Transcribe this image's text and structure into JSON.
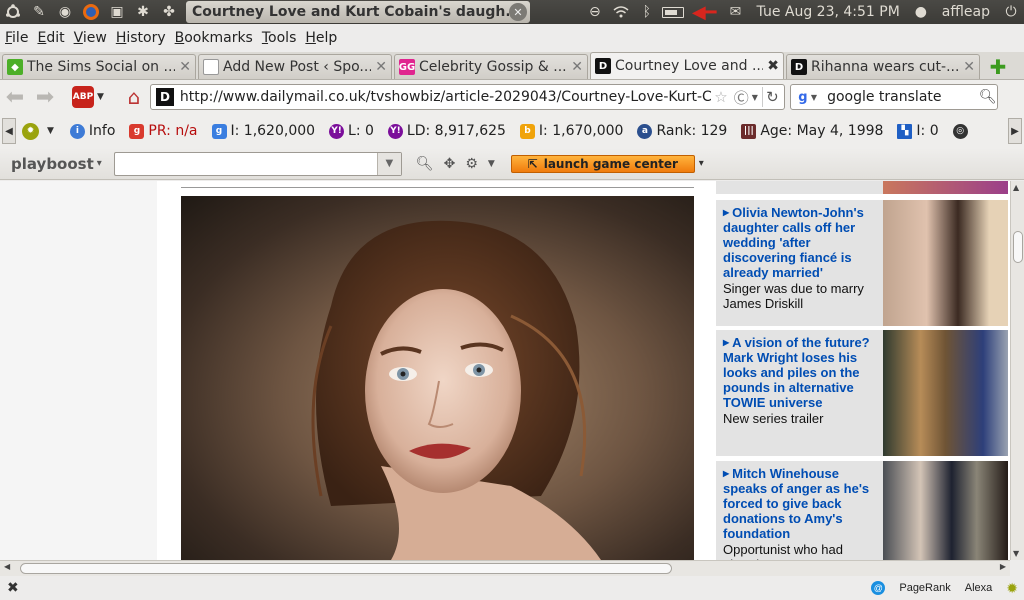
{
  "panel": {
    "active_task": "Courtney Love and Kurt Cobain's daugh...",
    "clock": "Tue Aug 23,  4:51 PM",
    "user": "affleap"
  },
  "menu": [
    "File",
    "Edit",
    "View",
    "History",
    "Bookmarks",
    "Tools",
    "Help"
  ],
  "tabs": [
    {
      "label": "The Sims Social on ...",
      "favicon": "sims-icon",
      "color": "#4caf28"
    },
    {
      "label": "Add New Post ‹ Spo...",
      "favicon": "page-icon",
      "color": "#ffffff"
    },
    {
      "label": "Celebrity Gossip & ...",
      "favicon": "gg-icon",
      "color": "#e0258f"
    },
    {
      "label": "Courtney Love and ...",
      "favicon": "dailymail-icon",
      "color": "#111111",
      "active": true
    },
    {
      "label": "Rihanna wears cut-...",
      "favicon": "dailymail-icon",
      "color": "#111111"
    }
  ],
  "nav": {
    "url": "http://www.dailymail.co.uk/tvshowbiz/article-2029043/Courtney-Love-Kurt-Cobain",
    "search": "google translate",
    "abp_label": "ABP"
  },
  "seo": {
    "info": "Info",
    "pr": "PR: n/a",
    "google_index": "I: 1,620,000",
    "yahoo_links": "L: 0",
    "yahoo_ld": "LD: 8,917,625",
    "bing_index": "I: 1,670,000",
    "alexa_rank": "Rank: 129",
    "age": "Age: May 4, 1998",
    "delicious": "I: 0"
  },
  "playboost": {
    "logo": "playboost",
    "launch": "launch game center"
  },
  "sidebar": [
    {
      "headline": "Olivia Newton-John's daughter calls off her wedding 'after discovering fiancé is already married'",
      "sub": "Singer was due to marry James Driskill"
    },
    {
      "headline": "A vision of the future? Mark Wright loses his looks and piles on the pounds in alternative TOWIE universe",
      "sub": "New series trailer"
    },
    {
      "headline": "Mitch Winehouse speaks of anger as he's forced to give back donations to Amy's foundation",
      "sub": "Opportunist who had already"
    }
  ],
  "status": {
    "pagerank": "PageRank",
    "alexa": "Alexa"
  }
}
